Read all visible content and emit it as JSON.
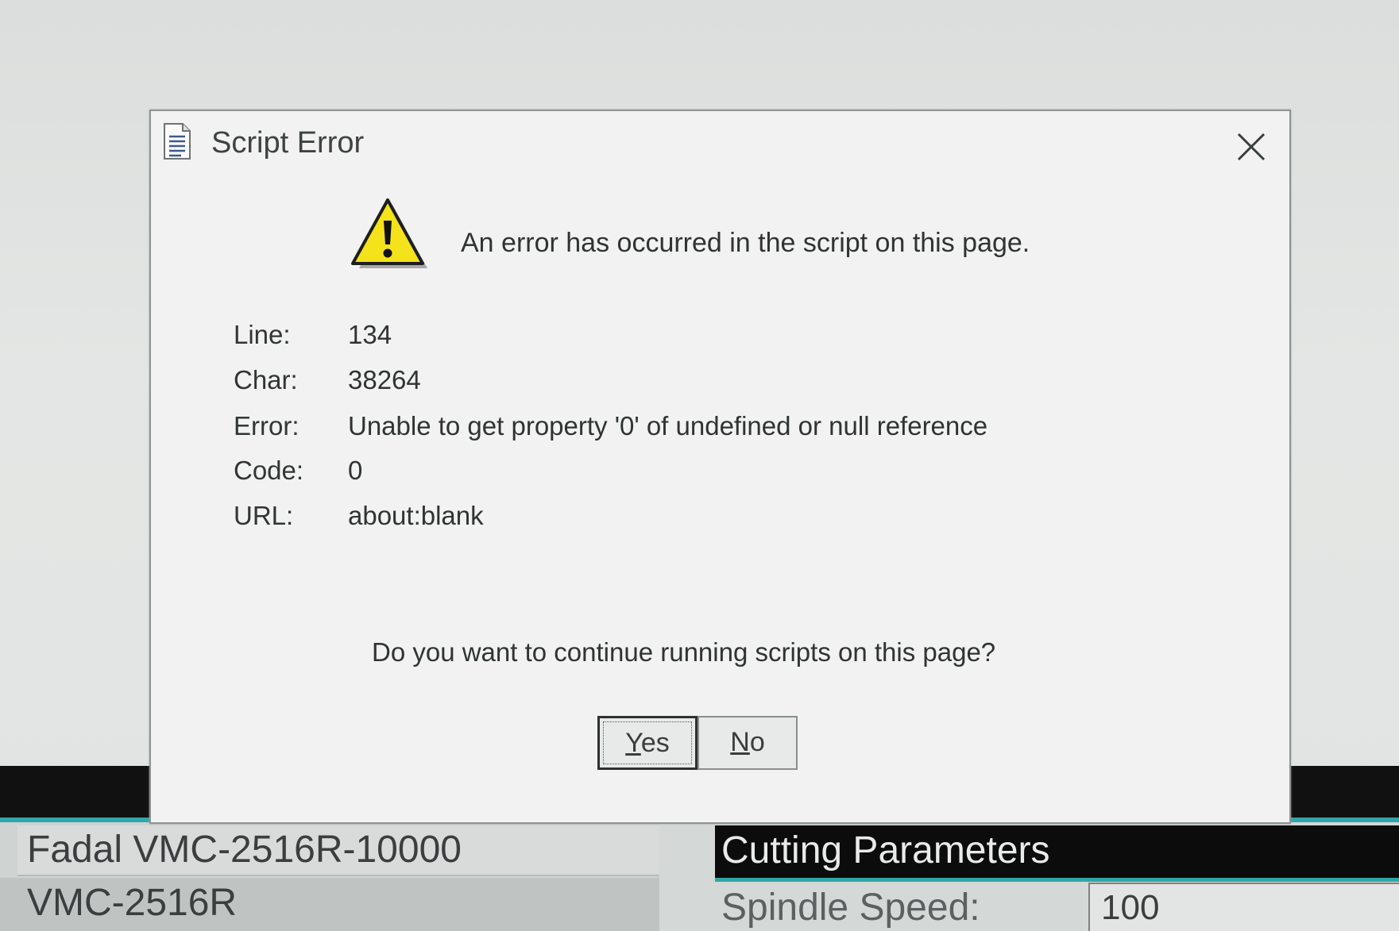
{
  "dialog": {
    "title": "Script Error",
    "message": "An error has occurred in the script on this page.",
    "details": [
      {
        "label": "Line:",
        "value": "134"
      },
      {
        "label": "Char:",
        "value": "38264"
      },
      {
        "label": "Error:",
        "value": "Unable to get property '0' of undefined or null reference"
      },
      {
        "label": "Code:",
        "value": "0"
      },
      {
        "label": "URL:",
        "value": "about:blank"
      }
    ],
    "question": "Do you want to continue running scripts on this page?",
    "yes_first": "Y",
    "yes_rest": "es",
    "no_first": "N",
    "no_rest": "o",
    "icons": {
      "title": "document-icon",
      "warning": "warning-icon",
      "close": "close-icon"
    }
  },
  "background": {
    "machine_name": "Fadal VMC-2516R-10000",
    "machine_model": "VMC-2516R",
    "section_title": "Cutting Parameters",
    "spindle_label": "Spindle Speed:",
    "spindle_value": "100"
  },
  "colors": {
    "accent": "#2fa7a8",
    "warning_yellow": "#f4e21a",
    "dialog_bg": "#f1f2f1"
  }
}
